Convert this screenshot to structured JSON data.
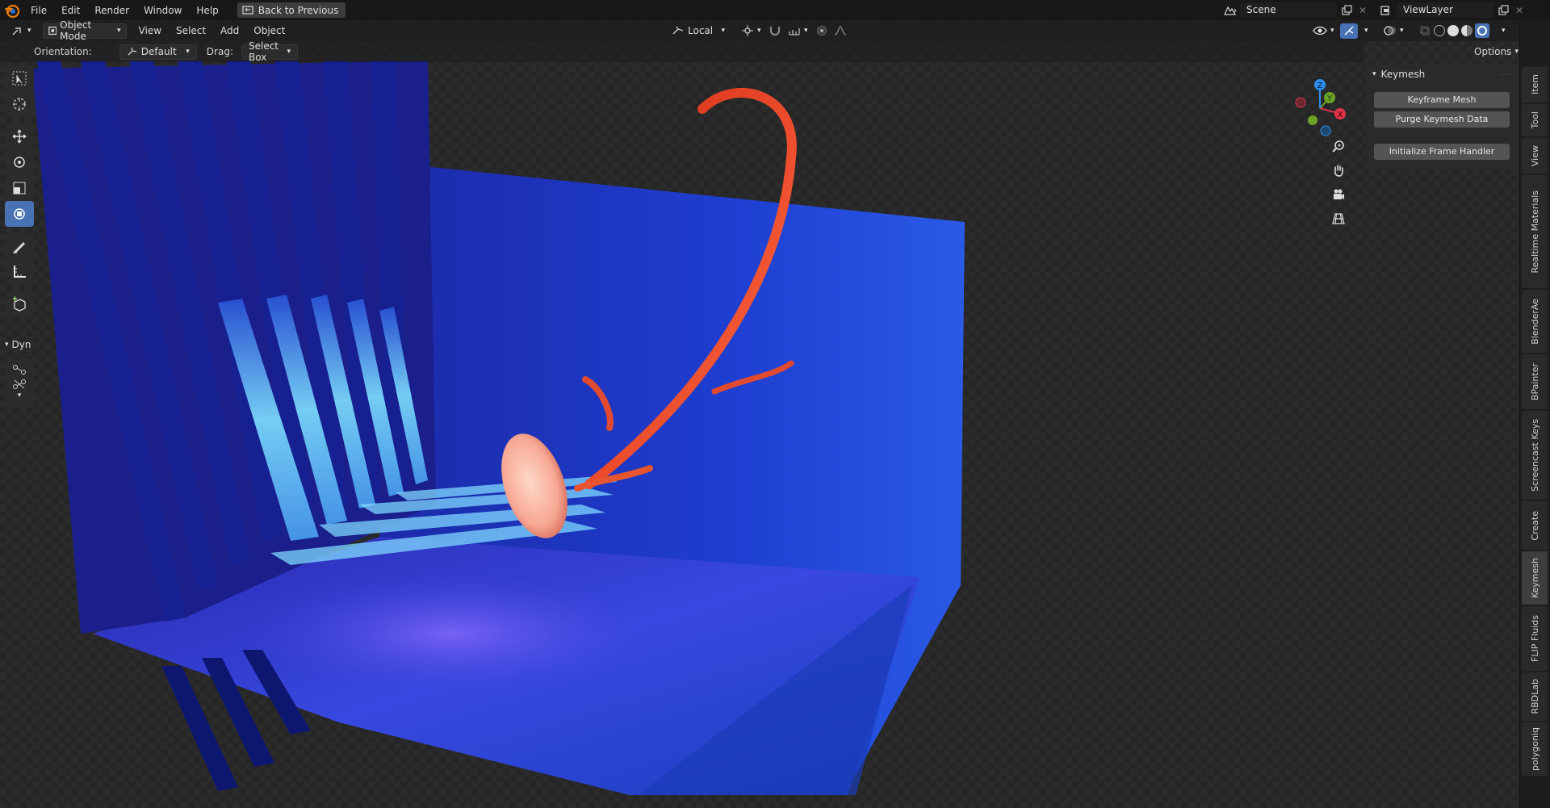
{
  "menubar": {
    "items": [
      "File",
      "Edit",
      "Render",
      "Window",
      "Help"
    ],
    "back_label": "Back to Previous",
    "scene_label": "Scene",
    "viewlayer_label": "ViewLayer"
  },
  "header": {
    "mode": "Object Mode",
    "menus": [
      "View",
      "Select",
      "Add",
      "Object"
    ],
    "pivot": "Local",
    "options_label": "Options"
  },
  "tool_settings": {
    "orientation_label": "Orientation:",
    "orientation_value": "Default",
    "drag_label": "Drag:",
    "drag_value": "Select Box"
  },
  "toolbar": {
    "tools": [
      "select-box-tool",
      "cursor-tool",
      "move-tool",
      "rotate-tool",
      "scale-tool",
      "transform-tool",
      "annotate-tool",
      "measure-tool",
      "add-cube-tool"
    ],
    "active": "transform-tool",
    "panel_label": "Dyn"
  },
  "nav_gizmo": {
    "x": "X",
    "y": "Y",
    "z": "Z"
  },
  "npanel": {
    "title": "Keymesh",
    "buttons": [
      "Keyframe Mesh",
      "Purge Keymesh Data",
      "Initialize Frame Handler"
    ]
  },
  "tabs": [
    "Item",
    "Tool",
    "View",
    "Realtime Materials",
    "BlenderAe",
    "BPainter",
    "Screencast Keys",
    "Create",
    "Keymesh",
    "FLIP Fluids",
    "RBDLab",
    "polygoniq"
  ],
  "active_tab": "Keymesh",
  "colors": {
    "accent": "#4772b3",
    "x_axis": "#e0334b",
    "y_axis": "#6aa325",
    "z_axis": "#2c8ff0"
  }
}
